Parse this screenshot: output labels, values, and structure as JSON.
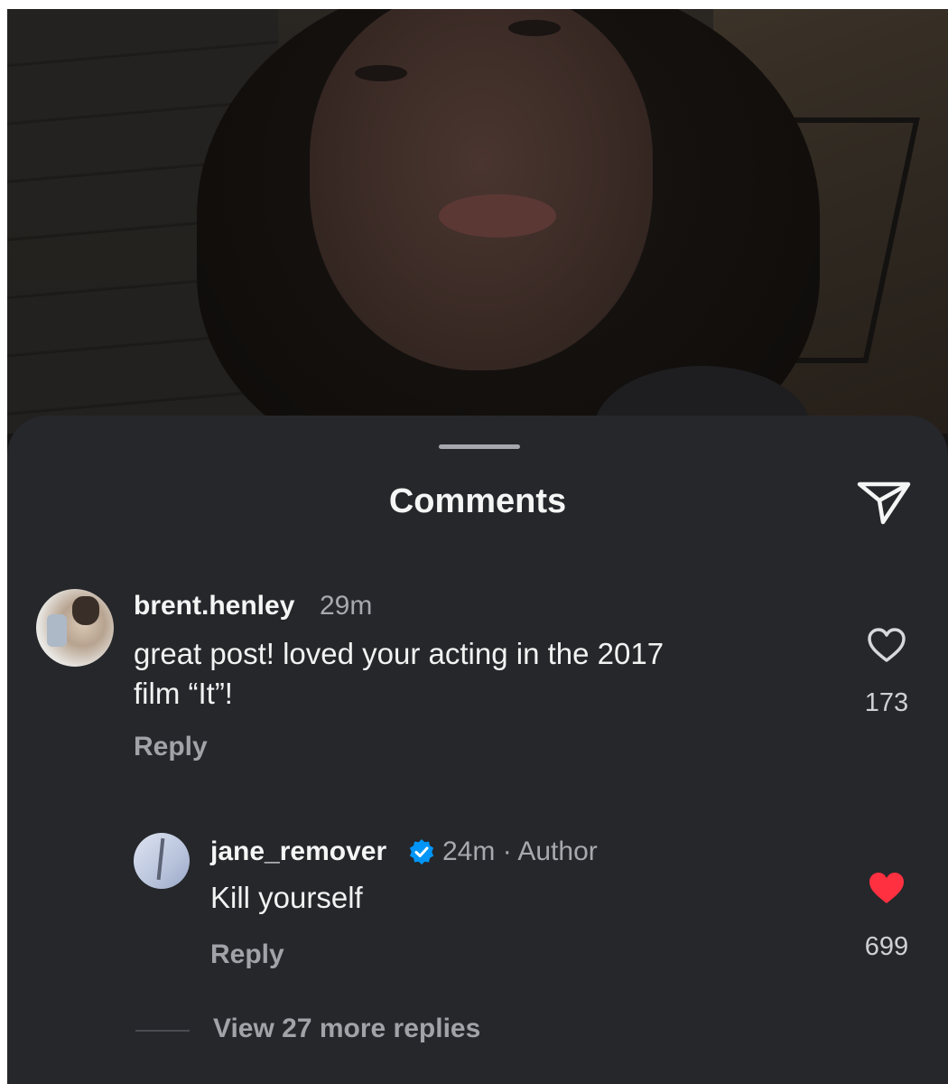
{
  "sheet": {
    "title": "Comments"
  },
  "comments": [
    {
      "username": "brent.henley",
      "time": "29m",
      "text_line1": "great post! loved your acting in the 2017",
      "text_line2": "film “It”!",
      "reply_label": "Reply",
      "likes": "173",
      "liked": false
    },
    {
      "username": "jane_remover",
      "verified": true,
      "time": "24m · Author",
      "text": "Kill yourself",
      "reply_label": "Reply",
      "likes": "699",
      "liked": true
    }
  ],
  "view_more_replies": "View 27 more replies",
  "colors": {
    "sheet_background": "#25272b",
    "liked_heart": "#ff3040",
    "verified_badge": "#0095f6"
  },
  "icons": [
    "send-icon",
    "heart-outline-icon",
    "heart-filled-icon",
    "verified-badge-icon"
  ]
}
